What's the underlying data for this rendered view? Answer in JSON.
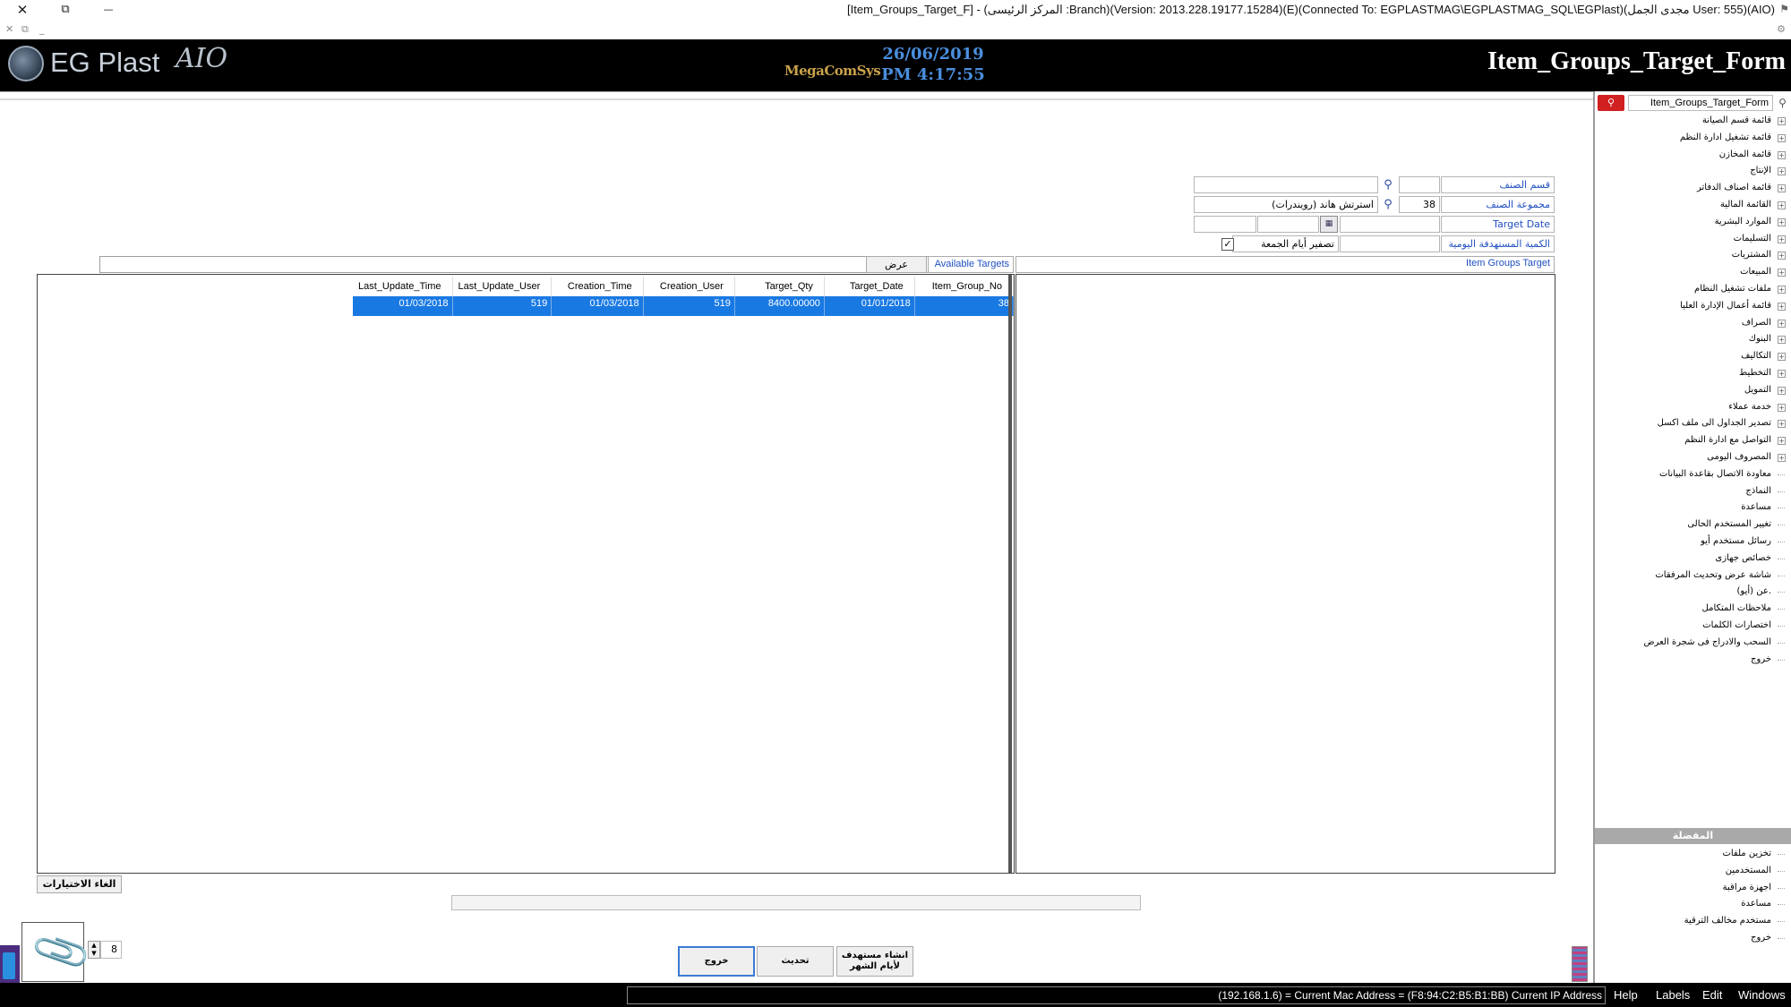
{
  "window": {
    "title": "[Item_Groups_Target_F] - (المركز الرئيسى :Branch)(Version: 2013.228.19177.15284)(E)(Connected To: EGPLASTMAG\\EGPLASTMAG_SQL\\EGPlast)(مجدى الجمل User: 555)(AIO)",
    "close": "✕",
    "restore": "⧉",
    "minimize": "—"
  },
  "header": {
    "logo_text": "EG Plast",
    "logo_script": "AIO",
    "brand_mid": "MegaComSys",
    "date": "26/06/2019",
    "time": "PM 4:17:55",
    "form_title": "Item_Groups_Target_Form"
  },
  "sidebar": {
    "search_value": "Item_Groups_Target_Form",
    "tree": [
      {
        "label": "قائمة قسم الصيانة",
        "expandable": true
      },
      {
        "label": "قائمة تشغيل ادارة النظم",
        "expandable": true
      },
      {
        "label": "قائمة المخازن",
        "expandable": true
      },
      {
        "label": "الإنتاج",
        "expandable": true
      },
      {
        "label": "قائمة اصناف الدفاتر",
        "expandable": true
      },
      {
        "label": "القائمة المالية",
        "expandable": true
      },
      {
        "label": "الموارد البشرية",
        "expandable": true
      },
      {
        "label": "التسليمات",
        "expandable": true
      },
      {
        "label": "المشتريات",
        "expandable": true
      },
      {
        "label": "المبيعات",
        "expandable": true
      },
      {
        "label": "ملفات تشغيل النظام",
        "expandable": true
      },
      {
        "label": "قائمة أعمال الإدارة العليا",
        "expandable": true
      },
      {
        "label": "الصراف",
        "expandable": true
      },
      {
        "label": "البنوك",
        "expandable": true
      },
      {
        "label": "التكاليف",
        "expandable": true
      },
      {
        "label": "التخطيط",
        "expandable": true
      },
      {
        "label": "التمويل",
        "expandable": true
      },
      {
        "label": "خدمة عملاء",
        "expandable": true
      },
      {
        "label": "تصدير الجداول الى ملف اكسل",
        "expandable": true
      },
      {
        "label": "التواصل مع ادارة النظم",
        "expandable": true
      },
      {
        "label": "المصروف اليومى",
        "expandable": true
      },
      {
        "label": "معاودة الاتصال بقاعدة البيانات",
        "expandable": false
      },
      {
        "label": "النماذج",
        "expandable": false
      },
      {
        "label": "مساعدة",
        "expandable": false
      },
      {
        "label": "تغيير المستخدم الحالى",
        "expandable": false
      },
      {
        "label": "رسائل مستخدم أيو",
        "expandable": false
      },
      {
        "label": "خصائص جهازى",
        "expandable": false
      },
      {
        "label": "شاشة عرض وتحديث المرفقات",
        "expandable": false
      },
      {
        "label": "عن (أيو).",
        "expandable": false
      },
      {
        "label": "ملاحظات المتكامل",
        "expandable": false
      },
      {
        "label": "اختصارات الكلمات",
        "expandable": false
      },
      {
        "label": "السحب والادراج فى شجرة العرض",
        "expandable": false
      },
      {
        "label": "خروج",
        "expandable": false
      }
    ],
    "section_title": "المفضلة",
    "favorites": [
      {
        "label": "تخزين ملفات"
      },
      {
        "label": "المستخدمين"
      },
      {
        "label": "اجهزة مراقبة"
      },
      {
        "label": "مساعدة"
      },
      {
        "label": "مستخدم مخالف الترقية"
      },
      {
        "label": "خروج"
      }
    ]
  },
  "form": {
    "category_label": "قسم الصنف",
    "category_code": "",
    "category_name": "",
    "group_label": "مجموعة الصنف",
    "group_code": "38",
    "group_name": "استرتش هاند (رويندرات)",
    "target_date_label": "Target Date",
    "target_date_value": "",
    "daily_qty_label": "الكمية المستهدفة اليومية",
    "daily_qty_value": "",
    "zero_friday_label": "تصفير أيام الجمعة",
    "zero_friday_checked": "✓",
    "show_button": "عرض",
    "available_targets_label": "Available Targets",
    "item_groups_target_label": "Item Groups Target"
  },
  "grid": {
    "columns": [
      "Last_Update_Time",
      "Last_Update_User",
      "Creation_Time",
      "Creation_User",
      "Target_Qty",
      "Target_Date",
      "Item_Group_No"
    ],
    "rows": [
      {
        "Last_Update_Time": "01/03/2018",
        "Last_Update_User": "519",
        "Creation_Time": "01/03/2018",
        "Creation_User": "519",
        "Target_Qty": "8400.00000",
        "Target_Date": "01/01/2018",
        "Item_Group_No": "38"
      }
    ]
  },
  "buttons": {
    "clear_selection": "الغاء الاختيارات",
    "exit": "خروج",
    "refresh": "تحديث",
    "create_line1": "انشاء مستهدف",
    "create_line2": "لأيام الشهر"
  },
  "pager": {
    "value": "8"
  },
  "statusbar": {
    "info": "(192.168.1.6) = Current Mac Address = (F8:94:C2:B5:B1:BB) Current IP Address",
    "menu": [
      "Help",
      "Labels",
      "Edit",
      "Windows"
    ]
  },
  "colors": {
    "selection": "#1e7be0",
    "link_blue": "#2050c0",
    "header_bg": "#000000",
    "date_blue": "#4a8ede",
    "search_red": "#d02020"
  }
}
